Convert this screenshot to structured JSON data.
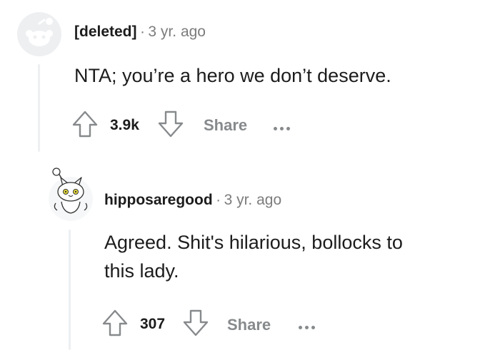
{
  "comments": [
    {
      "author": "[deleted]",
      "separator": "·",
      "time": "3 yr. ago",
      "body": "NTA; you’re a hero we don’t deserve.",
      "votes": "3.9k",
      "share_label": "Share",
      "more_icon": "more-horizontal-icon",
      "avatar_icon": "default-snoo-avatar"
    },
    {
      "author": "hipposaregood",
      "separator": "·",
      "time": "3 yr. ago",
      "body_line1": "Agreed. Shit's hilarious, bollocks to",
      "body_line2": "this lady.",
      "votes": "307",
      "share_label": "Share",
      "more_icon": "more-horizontal-icon",
      "avatar_icon": "cat-snoo-avatar"
    }
  ],
  "icons": {
    "upvote": "upvote-arrow-icon",
    "downvote": "downvote-arrow-icon"
  },
  "colors": {
    "meta_gray": "#7c7c7c",
    "action_gray": "#878a8c",
    "thread_line": "#edeff1"
  }
}
